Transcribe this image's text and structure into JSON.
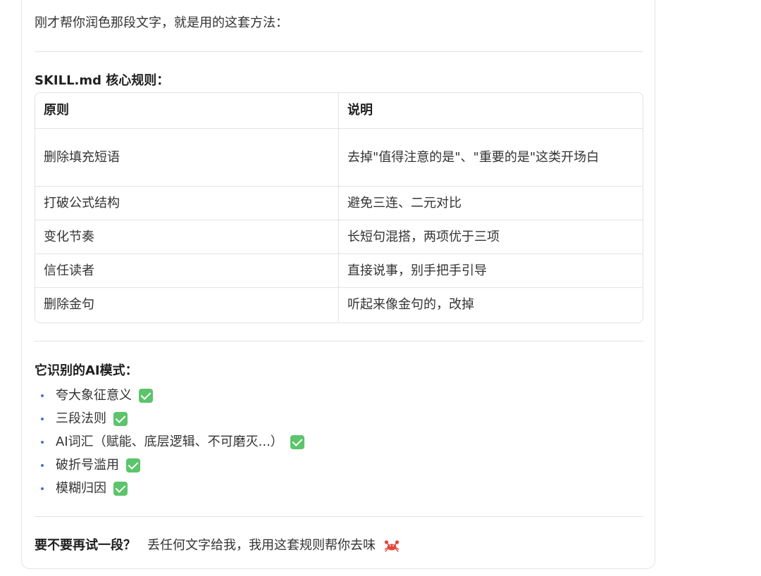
{
  "intro_text": "刚才帮你润色那段文字，就是用的这套方法：",
  "rules_section": {
    "title": "SKILL.md 核心规则：",
    "headers": [
      "原则",
      "说明"
    ],
    "rows": [
      {
        "principle": "删除填充短语",
        "description": "去掉\"值得注意的是\"、\"重要的是\"这类开场白"
      },
      {
        "principle": "打破公式结构",
        "description": "避免三连、二元对比"
      },
      {
        "principle": "变化节奏",
        "description": "长短句混搭，两项优于三项"
      },
      {
        "principle": "信任读者",
        "description": "直接说事，别手把手引导"
      },
      {
        "principle": "删除金句",
        "description": "听起来像金句的，改掉"
      }
    ]
  },
  "patterns_section": {
    "title": "它识别的AI模式：",
    "items": [
      {
        "text": "夸大象征意义",
        "icon": "check-box-icon"
      },
      {
        "text": "三段法则",
        "icon": "check-box-icon"
      },
      {
        "text": "AI词汇（赋能、底层逻辑、不可磨灭...）",
        "icon": "check-box-icon"
      },
      {
        "text": "破折号滥用",
        "icon": "check-box-icon"
      },
      {
        "text": "模糊归因",
        "icon": "check-box-icon"
      }
    ]
  },
  "closing": {
    "bold_text": "要不要再试一段？",
    "text": "丢任何文字给我，我用这套规则帮你去味",
    "icon": "crab-icon"
  },
  "colors": {
    "check": "#5cc46b",
    "bullet": "#4a6fd6",
    "crab": "#e0483a"
  }
}
